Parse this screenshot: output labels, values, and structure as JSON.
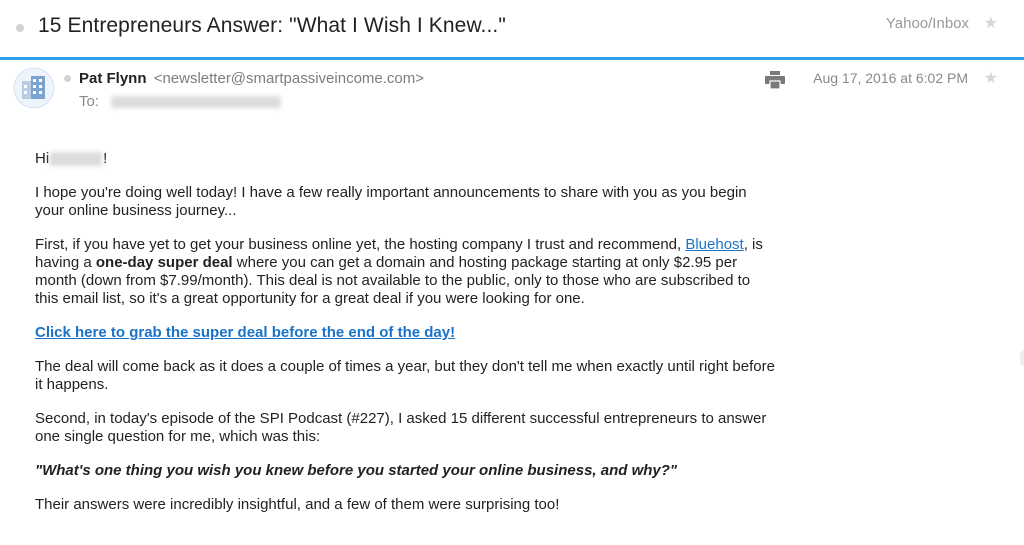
{
  "header": {
    "subject": "15 Entrepreneurs Answer: \"What I Wish I Knew...\"",
    "mailbox": "Yahoo/Inbox"
  },
  "sender": {
    "name": "Pat Flynn",
    "email": "<newsletter@smartpassiveincome.com>",
    "to_label": "To:",
    "date": "Aug 17, 2016 at 6:02 PM"
  },
  "body": {
    "greeting_prefix": "Hi",
    "greeting_suffix": "!",
    "p1": "I hope you're doing well today! I have a few really important announcements to share with you as you begin your online business journey...",
    "p2_start": "First, if you have yet to get your business online yet, the hosting company I trust and recommend, ",
    "p2_link": "Bluehost",
    "p2_mid": ", is having a ",
    "p2_bold": "one-day super deal",
    "p2_end": " where you can get a domain and hosting package starting at only $2.95 per month (down from $7.99/month). This deal is not available to the public, only to those who are subscribed to this email list, so it's a great opportunity for a great deal if you were looking for one.",
    "cta_link": "Click here to grab the super deal before the end of the day!",
    "p3": "The deal will come back as it does a couple of times a year, but they don't tell me when exactly until right before it happens.",
    "p4": "Second, in today's episode of the SPI Podcast (#227), I asked 15 different successful entrepreneurs to answer one single question for me, which was this:",
    "quote": "\"What's one thing you wish you knew before you started your online business, and why?\"",
    "p5": "Their answers were incredibly insightful, and a few of them were surprising too!"
  },
  "icons": {
    "avatar": "building-avatar-icon",
    "print": "print-icon",
    "star": "star-icon"
  },
  "colors": {
    "accent_line": "#2d9ee8",
    "link": "#1a73c9"
  }
}
